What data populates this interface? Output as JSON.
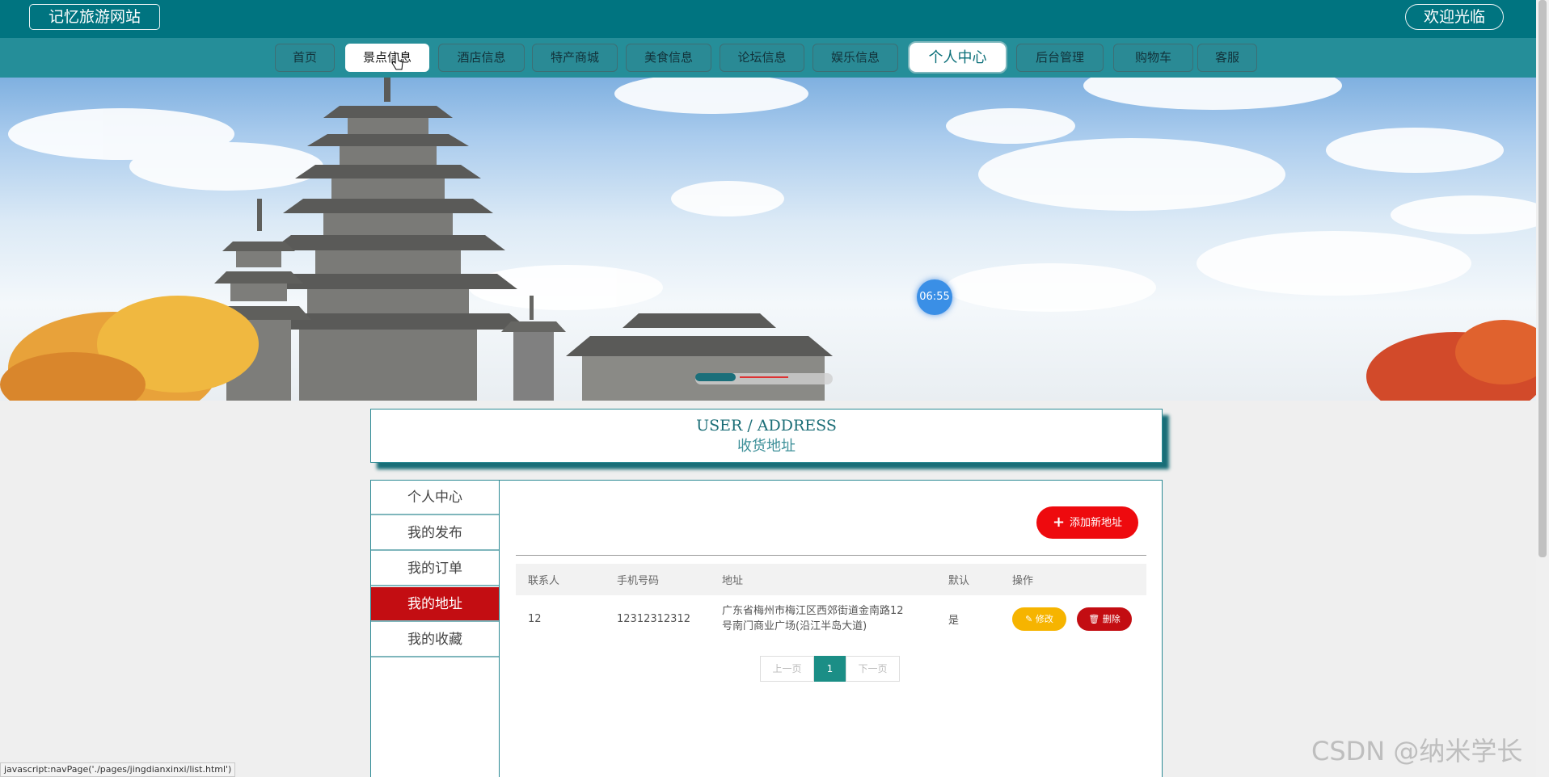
{
  "header": {
    "site_title": "记忆旅游网站",
    "welcome": "欢迎光临"
  },
  "nav": {
    "items": [
      {
        "label": "首页"
      },
      {
        "label": "景点信息"
      },
      {
        "label": "酒店信息"
      },
      {
        "label": "特产商城"
      },
      {
        "label": "美食信息"
      },
      {
        "label": "论坛信息"
      },
      {
        "label": "娱乐信息"
      },
      {
        "label": "个人中心"
      },
      {
        "label": "后台管理"
      },
      {
        "label": "购物车"
      },
      {
        "label": "客服"
      }
    ],
    "hovered": "景点信息",
    "active": "个人中心"
  },
  "banner": {
    "time_badge": "06:55",
    "carousel_slides": 4,
    "carousel_active_index": 0
  },
  "section": {
    "title_en": "USER / ADDRESS",
    "title_cn": "收货地址"
  },
  "sidebar": {
    "items": [
      {
        "label": "个人中心"
      },
      {
        "label": "我的发布"
      },
      {
        "label": "我的订单"
      },
      {
        "label": "我的地址"
      },
      {
        "label": "我的收藏"
      }
    ],
    "active": "我的地址"
  },
  "address": {
    "add_button": "添加新地址",
    "columns": [
      "联系人",
      "手机号码",
      "地址",
      "默认",
      "操作"
    ],
    "rows": [
      {
        "contact": "12",
        "phone": "12312312312",
        "address_line1": "广东省梅州市梅江区西郊街道金南路12",
        "address_line2": "号南门商业广场(沿江半岛大道)",
        "default": "是",
        "edit_label": "修改",
        "delete_label": "删除"
      }
    ]
  },
  "pagination": {
    "prev": "上一页",
    "current": "1",
    "next": "下一页"
  },
  "status_bar": "javascript:navPage('./pages/jingdianxinxi/list.html')",
  "watermark": "CSDN @纳米学长",
  "colors": {
    "header_bg": "#007480",
    "nav_bg": "#258e99",
    "active_red": "#c30d12",
    "add_button": "#ee0a0e",
    "edit_button": "#f6b400",
    "page_current": "#1b8e86"
  }
}
